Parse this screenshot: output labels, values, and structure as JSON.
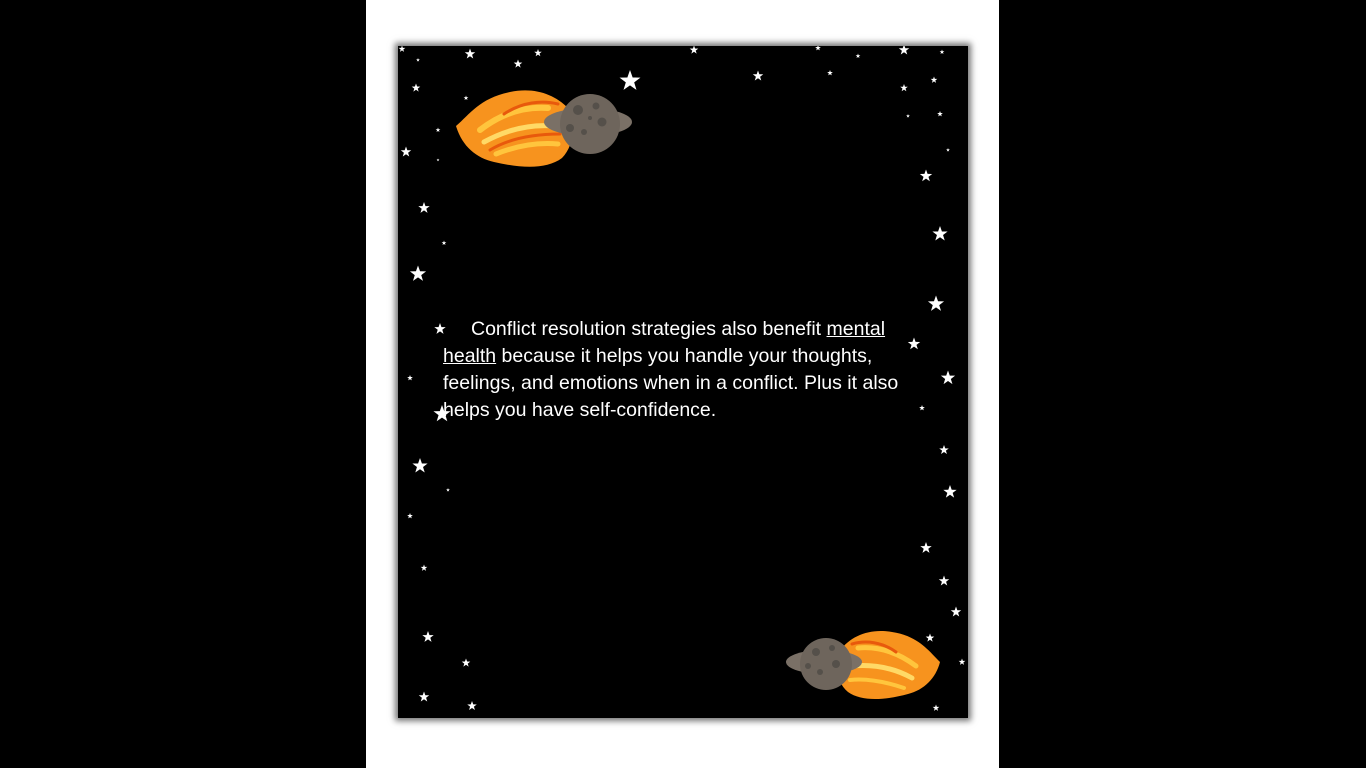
{
  "document": {
    "paragraph": {
      "lead": "Conflict resolution strategies also benefit ",
      "link_text": "mental health",
      "rest": " because it helps you handle your thoughts, feelings, and emotions when in a conflict. Plus it also helps you have self-confidence."
    }
  },
  "decorations": {
    "comet_top_icon": "comet-planet-icon",
    "comet_bottom_icon": "comet-planet-icon",
    "star_icon": "star-icon",
    "colors": {
      "frame_background": "#000000",
      "page_background": "#ffffff",
      "text": "#ffffff",
      "comet_orange": "#f7931e",
      "comet_yellow": "#ffc53d",
      "planet_gray": "#6e655c"
    }
  }
}
